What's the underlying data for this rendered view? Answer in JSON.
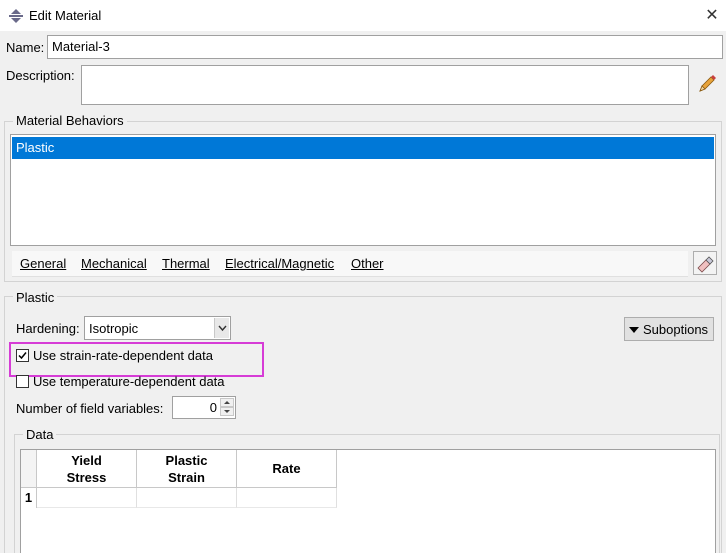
{
  "window": {
    "title": "Edit Material",
    "close": "✕"
  },
  "name": {
    "label": "Name:",
    "value": "Material-3"
  },
  "description": {
    "label": "Description:",
    "value": ""
  },
  "behaviors": {
    "group_title": "Material Behaviors",
    "items": [
      "Plastic"
    ],
    "selected_index": 0,
    "menus": [
      "General",
      "Mechanical",
      "Thermal",
      "Electrical/Magnetic",
      "Other"
    ]
  },
  "plastic": {
    "group_title": "Plastic",
    "hardening_label": "Hardening:",
    "hardening_value": "Isotropic",
    "suboptions_label": "Suboptions",
    "strain_rate_label": "Use strain-rate-dependent data",
    "strain_rate_checked": true,
    "temperature_label": "Use temperature-dependent data",
    "temperature_checked": false,
    "field_vars_label": "Number of field variables:",
    "field_vars_value": "0",
    "data_group_title": "Data",
    "table": {
      "columns": [
        {
          "line1": "Yield",
          "line2": "Stress"
        },
        {
          "line1": "Plastic",
          "line2": "Strain"
        },
        {
          "line1": "Rate",
          "line2": ""
        }
      ],
      "rows": [
        {
          "num": "1",
          "cells": [
            "",
            "",
            ""
          ]
        }
      ]
    }
  },
  "colors": {
    "selection": "#0078d7",
    "highlight": "#d63cd6"
  }
}
